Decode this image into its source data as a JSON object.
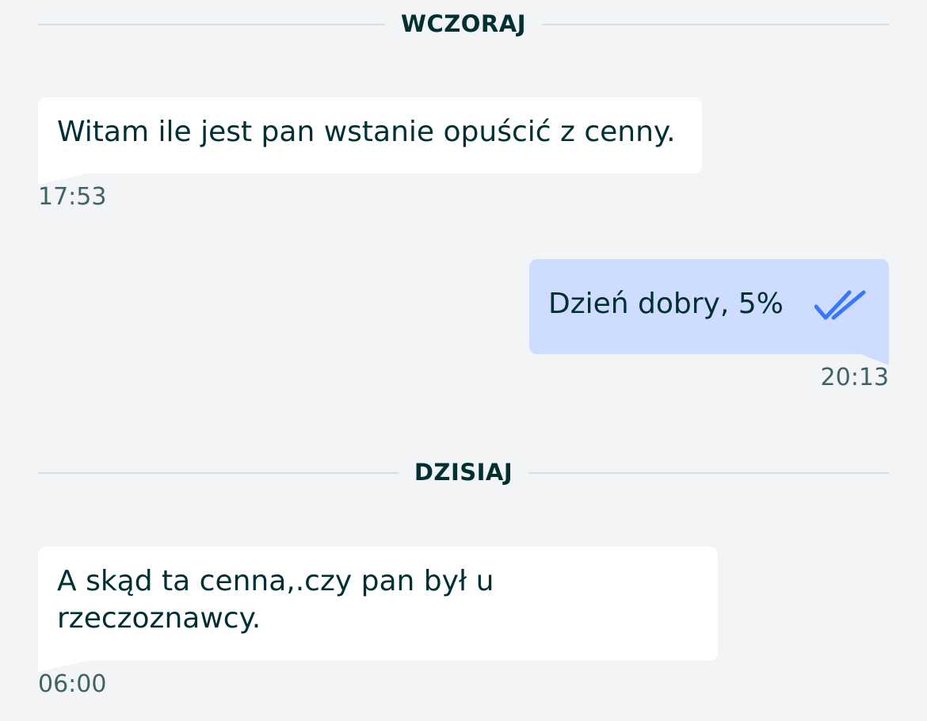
{
  "dividers": {
    "yesterday": "WCZORAJ",
    "today": "DZISIAJ"
  },
  "messages": [
    {
      "direction": "incoming",
      "text": "Witam ile jest pan wstanie opuścić z cenny.",
      "time": "17:53"
    },
    {
      "direction": "outgoing",
      "text": "Dzień dobry, 5%",
      "time": "20:13",
      "status_icon": "double-check-icon"
    },
    {
      "direction": "incoming",
      "text": "A skąd ta cenna,.czy pan był u rzeczoznawcy.",
      "time": "06:00"
    }
  ],
  "colors": {
    "background": "#f2f4f5",
    "incoming_bubble": "#ffffff",
    "outgoing_bubble": "#ceddff",
    "text": "#002f34",
    "timestamp": "#406367",
    "read_check": "#3a77ff"
  }
}
